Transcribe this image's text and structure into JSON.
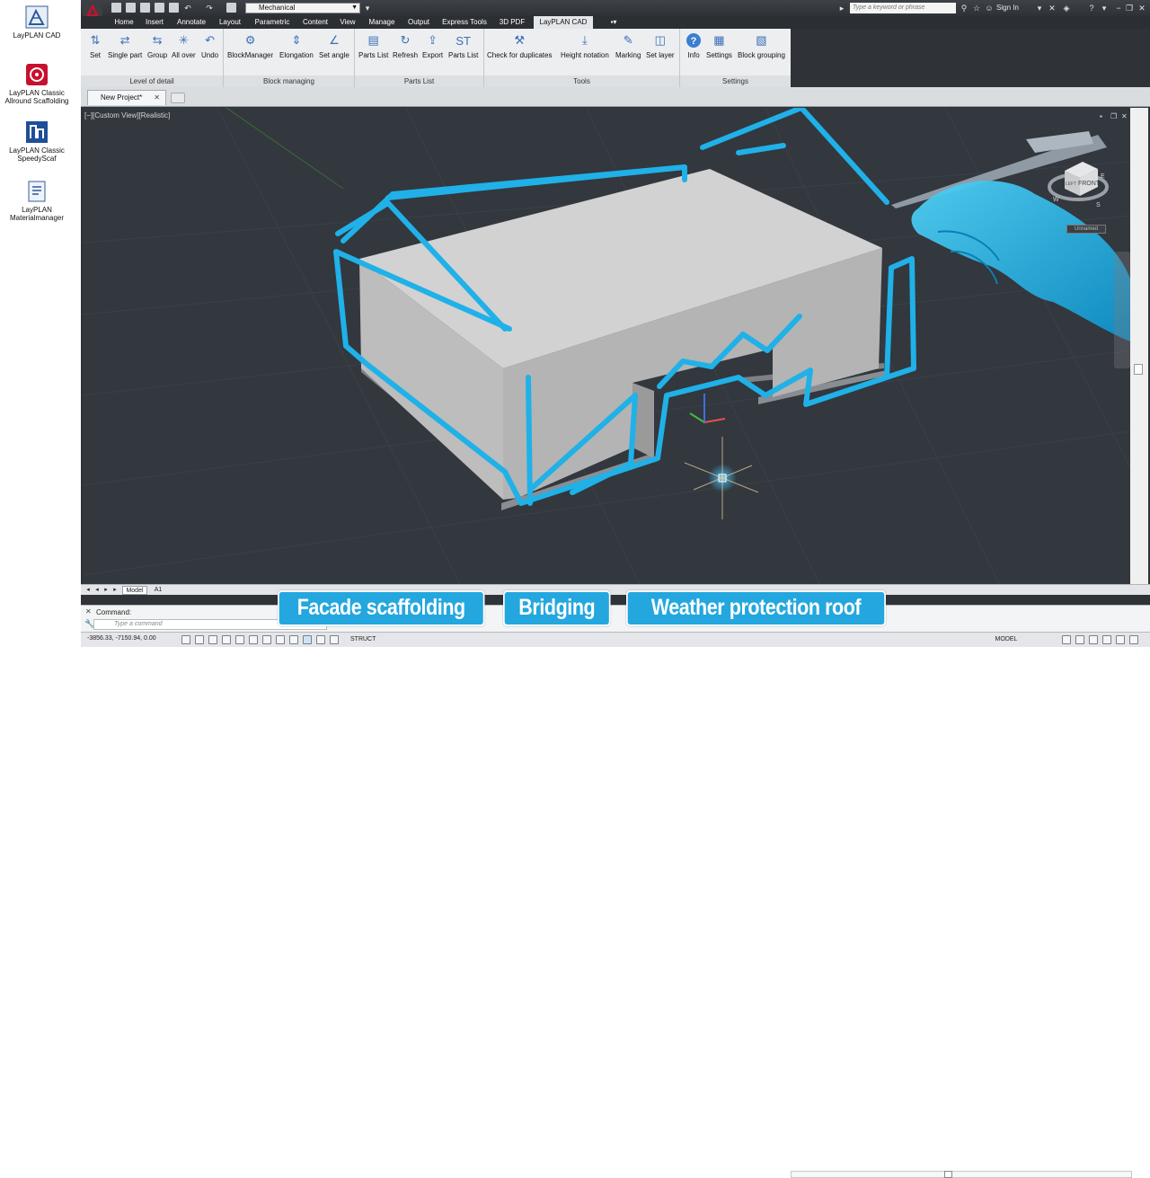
{
  "desktop": {
    "icons": [
      {
        "label_line1": "LayPLAN CAD",
        "label_line2": ""
      },
      {
        "label_line1": "LayPLAN Classic",
        "label_line2": "Allround Scaffolding"
      },
      {
        "label_line1": "LayPLAN Classic",
        "label_line2": "SpeedyScaf"
      },
      {
        "label_line1": "LayPLAN",
        "label_line2": "Materialmanager"
      }
    ]
  },
  "titlebar": {
    "workspace": "Mechanical",
    "search_placeholder": "Type a keyword or phrase",
    "sign_in": "Sign In"
  },
  "menu": {
    "tabs": [
      "Home",
      "Insert",
      "Annotate",
      "Layout",
      "Parametric",
      "Content",
      "View",
      "Manage",
      "Output",
      "Express Tools",
      "3D PDF",
      "LayPLAN CAD"
    ],
    "active": "LayPLAN CAD"
  },
  "ribbon": {
    "panels": [
      {
        "title": "Level of detail",
        "buttons": [
          "Set",
          "Single part",
          "Group",
          "All over",
          "Undo"
        ]
      },
      {
        "title": "Block managing",
        "buttons": [
          "BlockManager",
          "Elongation",
          "Set angle"
        ]
      },
      {
        "title": "Parts List",
        "buttons": [
          "Parts List",
          "Refresh",
          "Export",
          "Parts List"
        ]
      },
      {
        "title": "Tools",
        "buttons": [
          "Check for duplicates",
          "Height notation",
          "Marking",
          "Set layer"
        ]
      },
      {
        "title": "Settings",
        "buttons": [
          "Info",
          "Settings",
          "Block grouping"
        ]
      }
    ]
  },
  "document": {
    "tab_title": "New Project*"
  },
  "viewport": {
    "label": "[−][Custom View][Realistic]",
    "viewcube_face": "FRONT",
    "viewcube_left": "LEFT",
    "compass": {
      "w": "W",
      "s": "S",
      "e": "E"
    },
    "ucs_label": "Unnamed"
  },
  "layout_tabs": [
    "Model",
    "A1"
  ],
  "command": {
    "history": "Command:",
    "placeholder": "Type a command"
  },
  "status": {
    "coords": "-3856.33, -7150.94, 0.00",
    "struct": "STRUCT",
    "model": "MODEL"
  },
  "captions": [
    "Facade scaffolding",
    "Bridging",
    "Weather protection roof"
  ],
  "colors": {
    "accent": "#23a7de",
    "sketch": "#1fb1e8",
    "viewport": "#33373e"
  }
}
